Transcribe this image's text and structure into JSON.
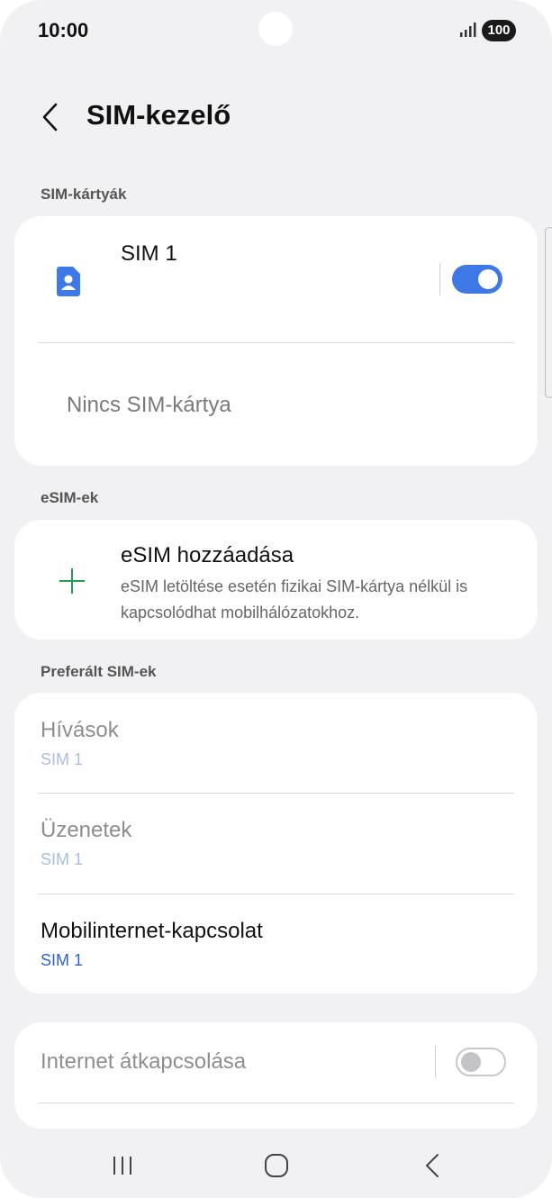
{
  "status_bar": {
    "time": "10:00",
    "battery": "100",
    "icons": [
      "signal-icon",
      "battery-icon"
    ]
  },
  "header": {
    "title": "SIM-kezelő",
    "back_icon": "chevron-left-icon"
  },
  "sections": {
    "sim_cards_label": "SIM-kártyák",
    "esims_label": "eSIM-ek",
    "preferred_label": "Preferált SIM-ek"
  },
  "sim_card": {
    "name": "SIM 1",
    "enabled": true,
    "icon": "sim-card-icon",
    "empty_slot_label": "Nincs SIM-kártya"
  },
  "esim": {
    "title": "eSIM hozzáadása",
    "description": "eSIM letöltése esetén fizikai SIM-kártya nélkül is kapcsolódhat mobilhálózatokhoz.",
    "icon": "plus-icon"
  },
  "preferred": [
    {
      "title": "Hívások",
      "value": "SIM 1",
      "enabled": false
    },
    {
      "title": "Üzenetek",
      "value": "SIM 1",
      "enabled": false
    },
    {
      "title": "Mobilinternet-kapcsolat",
      "value": "SIM 1",
      "enabled": true
    }
  ],
  "internet_switch": {
    "label": "Internet átkapcsolása",
    "enabled": false
  },
  "nav_bar": {
    "icons": [
      "recent-apps-icon",
      "home-icon",
      "back-icon"
    ]
  },
  "colors": {
    "accent": "#3e78e6",
    "link_blue": "#2f63c8",
    "plus_green": "#1f9d55",
    "background": "#f1f1f3"
  }
}
